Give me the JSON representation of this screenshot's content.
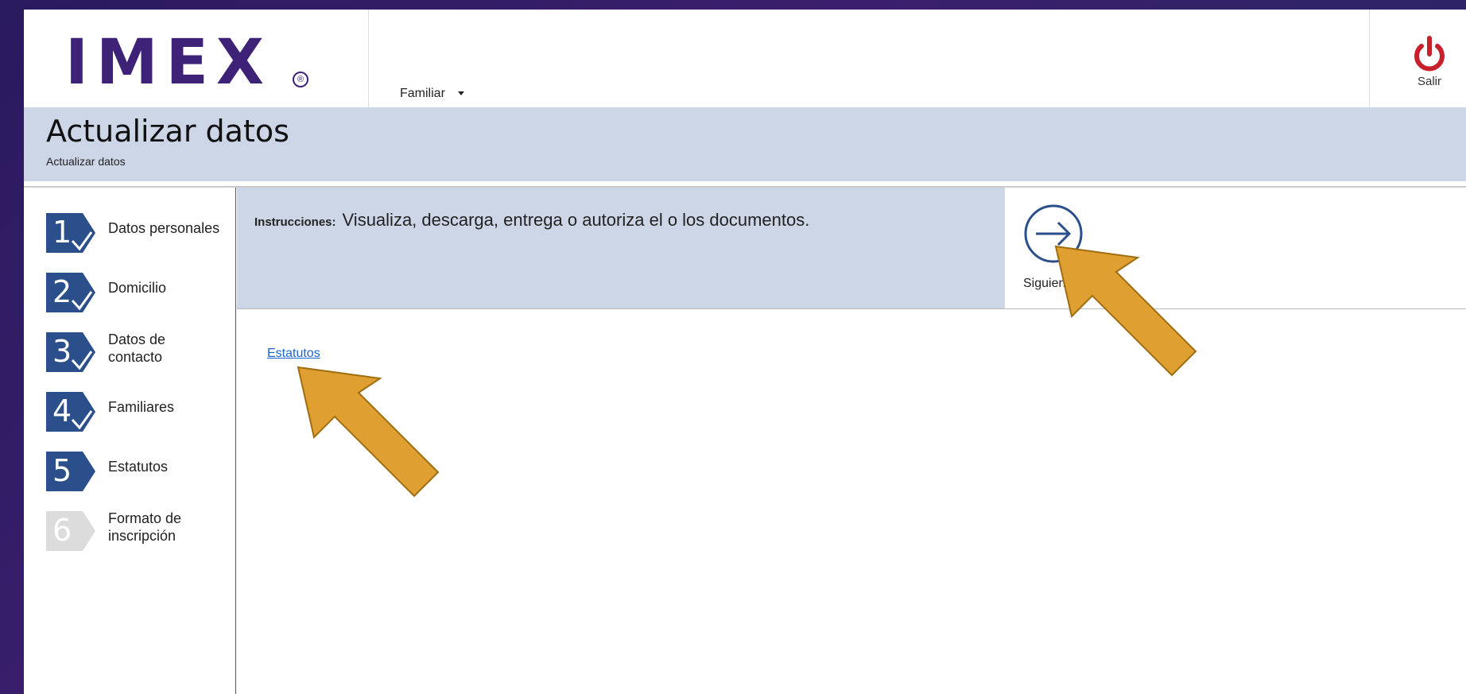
{
  "header": {
    "logo_text": "IMEX",
    "logo_mark": "®",
    "menu_label": "Familiar",
    "logout_label": "Salir",
    "logout_icon": "power-icon",
    "brand_color": "#3d2277",
    "logout_color": "#c8202a"
  },
  "title": {
    "main": "Actualizar datos",
    "breadcrumb": "Actualizar datos"
  },
  "steps": [
    {
      "number": "1",
      "label": "Datos personales",
      "status": "completed"
    },
    {
      "number": "2",
      "label": "Domicilio",
      "status": "completed"
    },
    {
      "number": "3",
      "label": "Datos de contacto",
      "status": "completed"
    },
    {
      "number": "4",
      "label": "Familiares",
      "status": "completed"
    },
    {
      "number": "5",
      "label": "Estatutos",
      "status": "current"
    },
    {
      "number": "6",
      "label": "Formato de inscripción",
      "status": "pending"
    }
  ],
  "instructions": {
    "label": "Instrucciones:",
    "text": "Visualiza, descarga, entrega o autoriza el o los documentos."
  },
  "next_button": {
    "label": "Siguiente",
    "icon": "arrow-right-circle-icon"
  },
  "documents": [
    {
      "label": "Estatutos"
    }
  ],
  "colors": {
    "step_active": "#2a4f8a",
    "step_pending": "#dcdcdc",
    "band": "#cdd6e6",
    "annotation_arrow": "#e0a031"
  }
}
